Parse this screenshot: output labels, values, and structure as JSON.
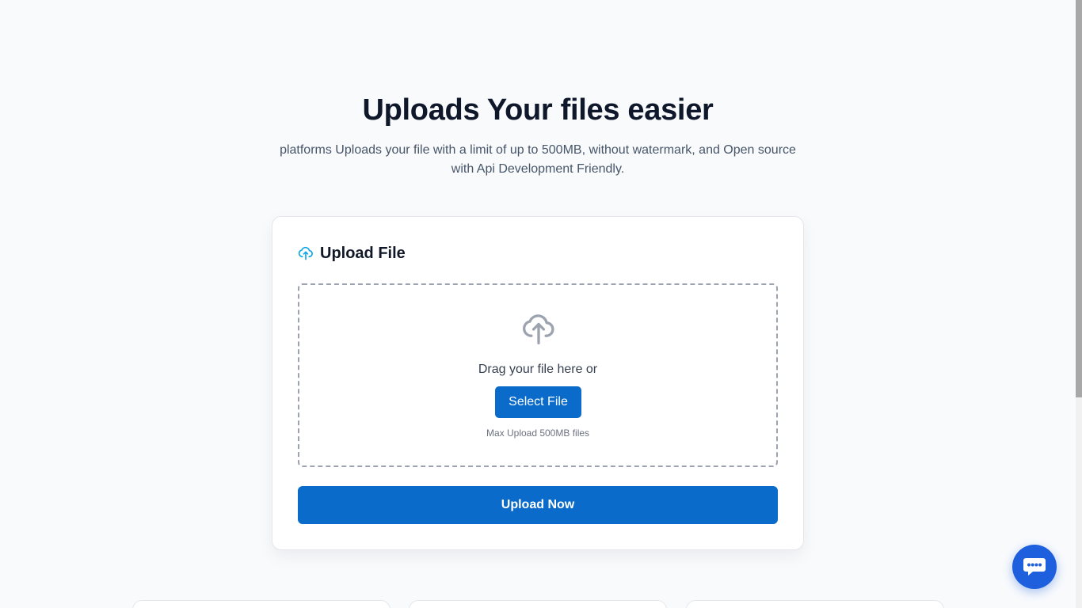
{
  "hero": {
    "title": "Uploads Your files easier",
    "subtitle": "platforms Uploads your file with a limit of up to 500MB, without watermark, and Open source with Api Development Friendly."
  },
  "upload_card": {
    "title": "Upload File",
    "header_icon": "upload-cloud-icon",
    "dropzone": {
      "icon": "cloud-upload-icon",
      "text": "Drag your file here or",
      "select_label": "Select File",
      "hint": "Max Upload 500MB files"
    },
    "submit_label": "Upload Now"
  },
  "chat": {
    "icon": "chat-bubble-icon"
  },
  "colors": {
    "primary": "#0a6bcb",
    "chat": "#1d5fdd",
    "background": "#f8fafc"
  }
}
